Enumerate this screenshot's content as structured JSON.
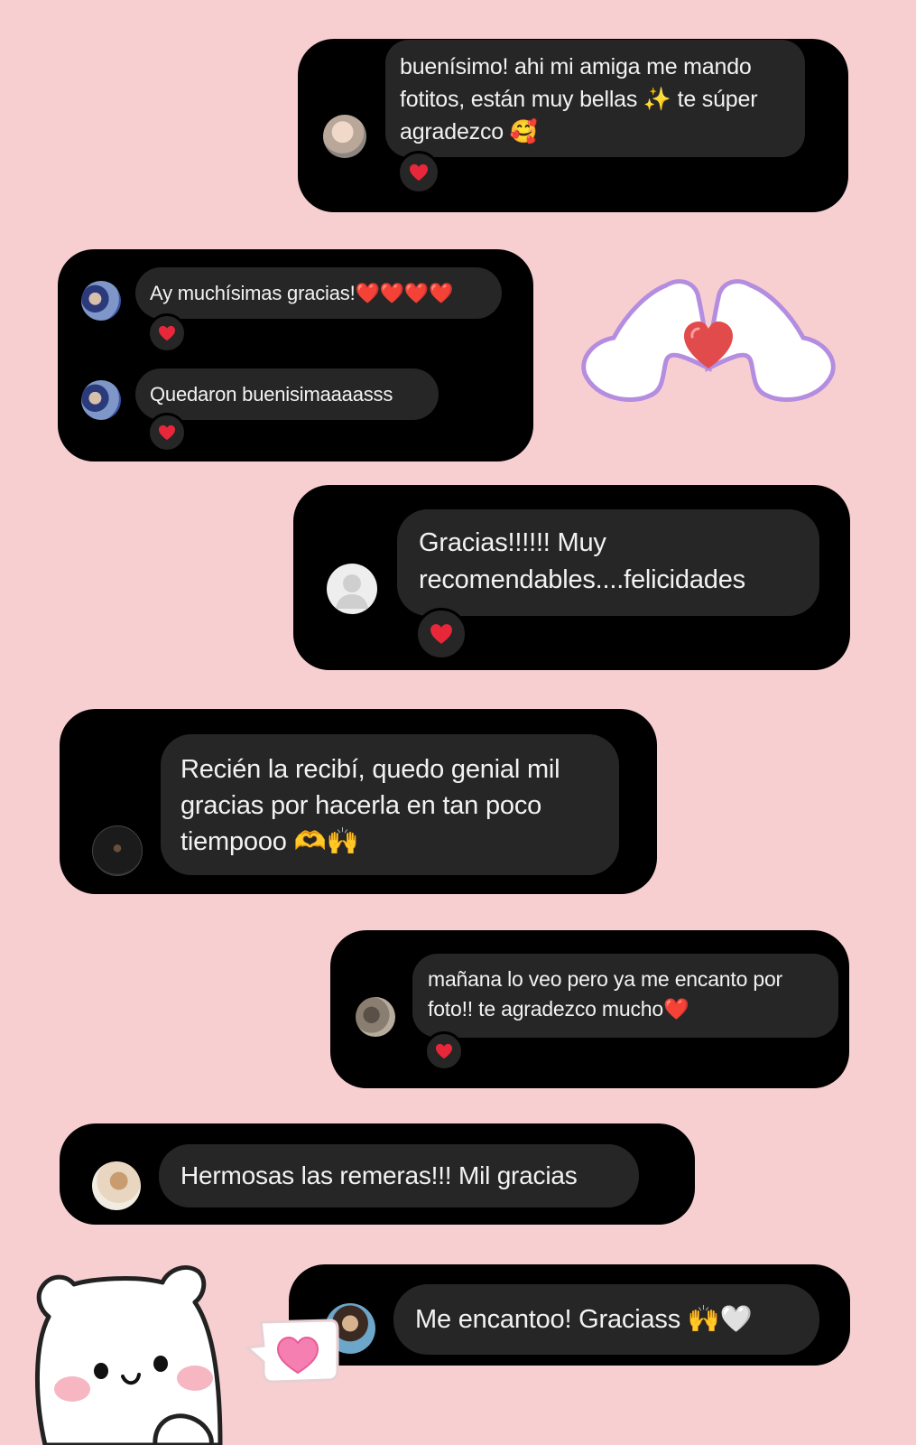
{
  "colors": {
    "background": "#f8cfd0",
    "card": "#000000",
    "bubble": "#262626",
    "text": "#f2f2f2",
    "heart": "#e8283a"
  },
  "messages": [
    {
      "id": "m1",
      "text": "buenísimo! ahi mi amiga me mando\nfotitos, están muy bellas ✨ te súper\nagradezco 🥰",
      "reaction": "heart"
    },
    {
      "id": "m2",
      "text": "Ay muchísimas gracias!❤️❤️❤️❤️",
      "reaction": "heart"
    },
    {
      "id": "m3",
      "text": "Quedaron buenisimaaaasss",
      "reaction": "heart"
    },
    {
      "id": "m4",
      "text": "Gracias!!!!!! Muy\nrecomendables....felicidades",
      "reaction": "heart"
    },
    {
      "id": "m5",
      "text": "Recién la recibí, quedo genial mil\ngracias por hacerla en tan poco\ntiempooo 🫶🙌",
      "reaction": null
    },
    {
      "id": "m6",
      "text": "mañana lo veo pero ya me encanto por\nfoto!! te agradezco mucho❤️",
      "reaction": "heart"
    },
    {
      "id": "m7",
      "text": "Hermosas las remeras!!! Mil gracias",
      "reaction": null
    },
    {
      "id": "m8",
      "text": "Me encantoo! Graciass 🙌🤍",
      "reaction": null
    }
  ],
  "stickers": [
    "heart-hands-sticker",
    "white-bear-sticker",
    "heart-speech-bubble-sticker"
  ]
}
